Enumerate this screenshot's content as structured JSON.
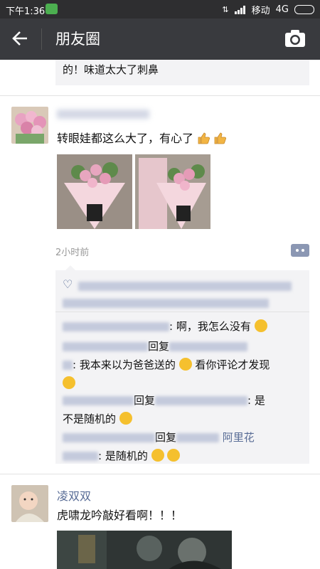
{
  "status": {
    "time": "下午1:36",
    "carrier": "移动",
    "network": "4G"
  },
  "nav": {
    "back_icon": "arrow-left-icon",
    "title": "朋友圈",
    "camera_icon": "camera-icon"
  },
  "prev_comment": {
    "text": "的！味道太大了刺鼻"
  },
  "post1": {
    "text": "转眼娃都这么大了，有心了",
    "time": "2小时前",
    "comments": [
      {
        "text": ": 啊，我怎么没有"
      },
      {
        "reply": "回复",
        "text": ": 我本来以为爸爸送的",
        "text2": "看你评论才发现"
      },
      {
        "reply": "回复",
        "text": ": 是",
        "text2": "不是随机的"
      },
      {
        "reply": "回复",
        "extra": " 阿里花",
        "text": ": 是随机的"
      }
    ]
  },
  "post2": {
    "name": "凌双双",
    "text": "虎啸龙吟敲好看啊！！！"
  }
}
